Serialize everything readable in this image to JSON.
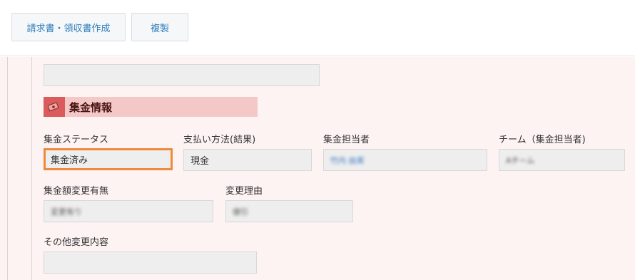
{
  "toolbar": {
    "invoice_button": "請求書・領収書作成",
    "copy_button": "複製"
  },
  "section": {
    "title": "集金情報",
    "icon": "money-bill-icon"
  },
  "fields": {
    "collection_status": {
      "label": "集金ステータス",
      "value": "集金済み"
    },
    "payment_method": {
      "label": "支払い方法(結果)",
      "value": "現金"
    },
    "collector": {
      "label": "集金担当者",
      "value": "竹内 由実"
    },
    "team": {
      "label": "チーム（集金担当者)",
      "value": "Aチーム"
    },
    "amount_change": {
      "label": "集金額変更有無",
      "value": "変更有り"
    },
    "change_reason": {
      "label": "変更理由",
      "value": "値引"
    },
    "other_changes": {
      "label": "その他変更内容",
      "value": ""
    }
  },
  "colors": {
    "accent": "#2f7fbd",
    "section_bg": "#f5c8c8",
    "panel_bg": "#fdf3f3",
    "focus_border": "#ee8a3c"
  }
}
